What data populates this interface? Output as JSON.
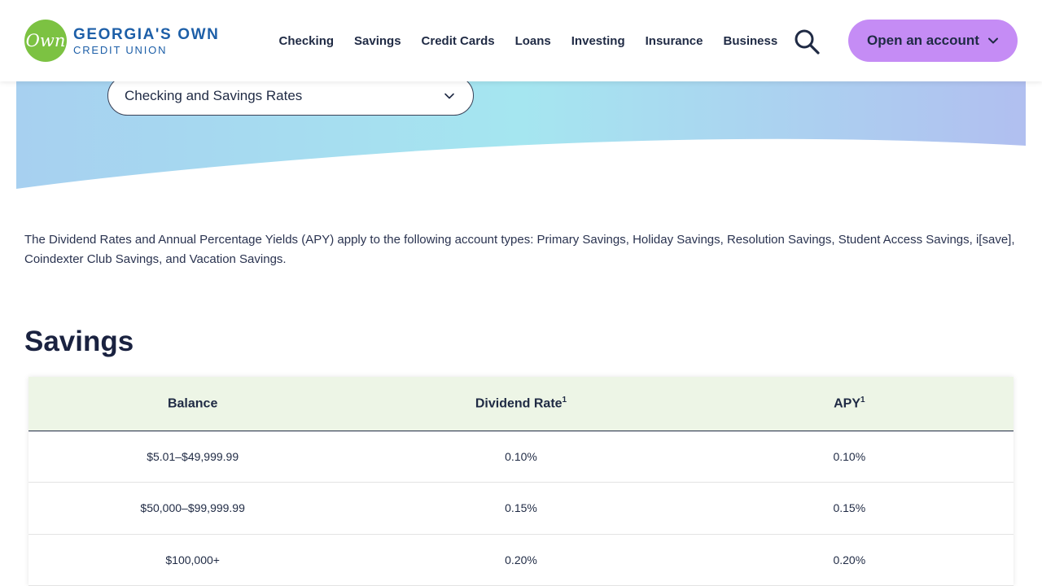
{
  "header": {
    "logo_mark": "Own",
    "logo_name": "GEORGIA'S OWN",
    "logo_sub": "CREDIT UNION",
    "nav": [
      "Checking",
      "Savings",
      "Credit Cards",
      "Loans",
      "Investing",
      "Insurance",
      "Business"
    ],
    "open_account_label": "Open an account"
  },
  "rate_selector": {
    "value": "Checking and Savings Rates"
  },
  "intro_text": "The Dividend Rates and Annual Percentage Yields (APY) apply to the following account types: Primary Savings, Holiday Savings, Resolution Savings, Student Access Savings, i[save], Coindexter Club Savings, and Vacation Savings.",
  "section_title": "Savings",
  "table": {
    "headers": [
      {
        "label": "Balance",
        "sup": ""
      },
      {
        "label": "Dividend Rate",
        "sup": "1"
      },
      {
        "label": "APY",
        "sup": "1"
      }
    ],
    "rows": [
      [
        "$5.01–$49,999.99",
        "0.10%",
        "0.10%"
      ],
      [
        "$50,000–$99,999.99",
        "0.15%",
        "0.15%"
      ],
      [
        "$100,000+",
        "0.20%",
        "0.20%"
      ]
    ]
  },
  "colors": {
    "brand_green": "#7cc242",
    "brand_blue": "#1d5fa8",
    "button_purple": "#c58cf5",
    "table_header_bg": "#edf5e6",
    "hero_gradient": [
      "#a7d0f0",
      "#a5e6f0",
      "#b1bff0"
    ]
  },
  "icons": [
    "search-icon",
    "chevron-down-icon"
  ]
}
